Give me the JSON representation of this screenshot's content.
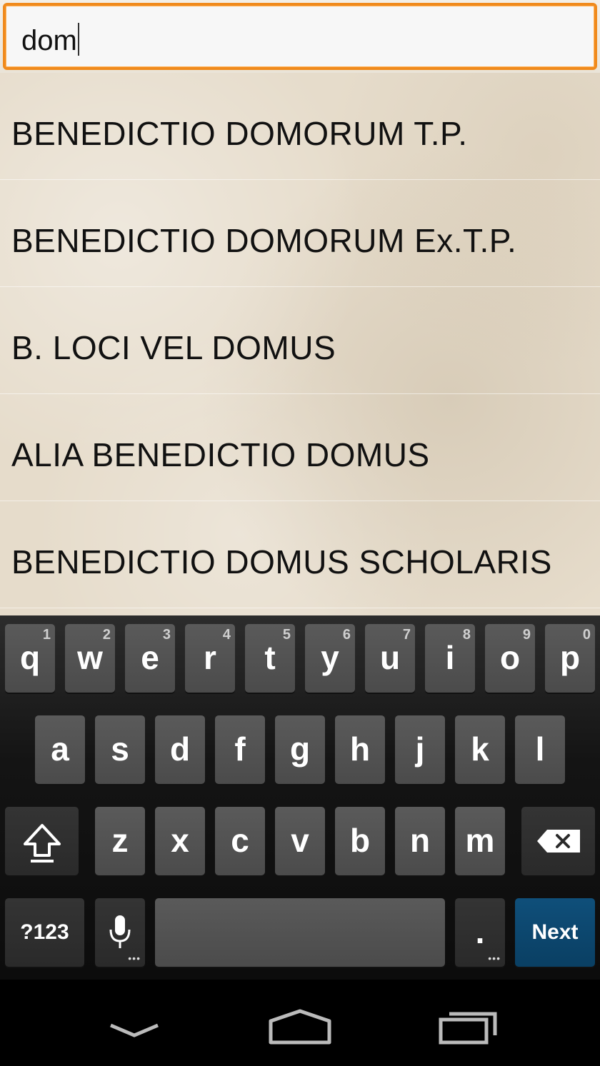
{
  "search": {
    "value": "dom"
  },
  "results": [
    "BENEDICTIO DOMORUM T.P.",
    "BENEDICTIO DOMORUM Ex.T.P.",
    "B. LOCI VEL DOMUS",
    "ALIA BENEDICTIO DOMUS",
    "BENEDICTIO DOMUS SCHOLARIS"
  ],
  "keyboard": {
    "row1": [
      {
        "c": "q",
        "h": "1"
      },
      {
        "c": "w",
        "h": "2"
      },
      {
        "c": "e",
        "h": "3"
      },
      {
        "c": "r",
        "h": "4"
      },
      {
        "c": "t",
        "h": "5"
      },
      {
        "c": "y",
        "h": "6"
      },
      {
        "c": "u",
        "h": "7"
      },
      {
        "c": "i",
        "h": "8"
      },
      {
        "c": "o",
        "h": "9"
      },
      {
        "c": "p",
        "h": "0"
      }
    ],
    "row2": [
      "a",
      "s",
      "d",
      "f",
      "g",
      "h",
      "j",
      "k",
      "l"
    ],
    "row3": [
      "z",
      "x",
      "c",
      "v",
      "b",
      "n",
      "m"
    ],
    "symbols_label": "?123",
    "period_label": ".",
    "next_label": "Next"
  },
  "icons": {
    "shift": "shift-icon",
    "backspace": "backspace-icon",
    "mic": "microphone-icon",
    "back": "back-icon",
    "home": "home-icon",
    "recents": "recent-apps-icon"
  },
  "colors": {
    "accent": "#f08a1c",
    "next_key": "#0a3f63"
  }
}
